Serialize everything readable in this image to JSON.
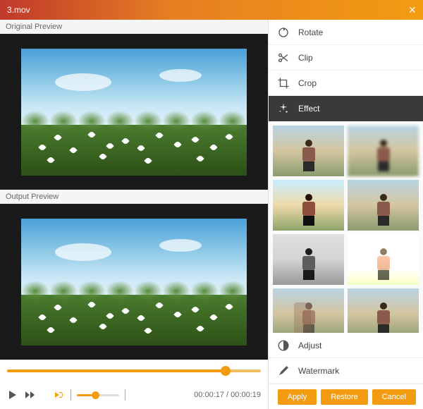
{
  "title": "3.mov",
  "sections": {
    "original": "Original Preview",
    "output": "Output Preview"
  },
  "playback": {
    "current": "00:00:17",
    "total": "00:00:19",
    "sep": " / "
  },
  "tools": [
    {
      "key": "rotate",
      "label": "Rotate",
      "active": false
    },
    {
      "key": "clip",
      "label": "Clip",
      "active": false
    },
    {
      "key": "crop",
      "label": "Crop",
      "active": false
    },
    {
      "key": "effect",
      "label": "Effect",
      "active": true
    },
    {
      "key": "adjust",
      "label": "Adjust",
      "active": false
    },
    {
      "key": "watermark",
      "label": "Watermark",
      "active": false
    }
  ],
  "buttons": {
    "apply": "Apply",
    "restore": "Restore",
    "cancel": "Cancel"
  }
}
